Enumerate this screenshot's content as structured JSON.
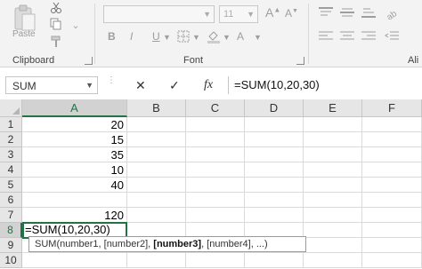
{
  "ribbon": {
    "clipboard": {
      "paste_label": "Paste",
      "group_label": "Clipboard",
      "icons": [
        "paste-icon",
        "cut-icon",
        "copy-icon",
        "format-painter-icon"
      ]
    },
    "font": {
      "group_label": "Font",
      "font_name": "",
      "font_size": "11",
      "bold": "B",
      "italic": "I",
      "underline": "U",
      "grow_font": "A",
      "shrink_font": "A",
      "font_color": "A"
    },
    "alignment": {
      "group_label_partial": "Ali"
    }
  },
  "formula_bar": {
    "name_box": "SUM",
    "formula": "=SUM(10,20,30)",
    "fx_label": "fx"
  },
  "grid": {
    "columns": [
      "A",
      "B",
      "C",
      "D",
      "E",
      "F"
    ],
    "rows": [
      "1",
      "2",
      "3",
      "4",
      "5",
      "6",
      "7",
      "8",
      "9",
      "10"
    ],
    "column_a_values": [
      "20",
      "15",
      "35",
      "10",
      "40",
      "",
      "120"
    ],
    "active_cell": {
      "ref": "A8",
      "text": "=SUM(10,20,30)"
    },
    "tooltip": {
      "prefix": "SUM(number1, [number2], ",
      "bold": "[number3]",
      "suffix": ", [number4], ...)"
    }
  },
  "colors": {
    "excel_green": "#217346",
    "ribbon_bg": "#f3f3f3",
    "header_bg": "#e6e6e6"
  }
}
